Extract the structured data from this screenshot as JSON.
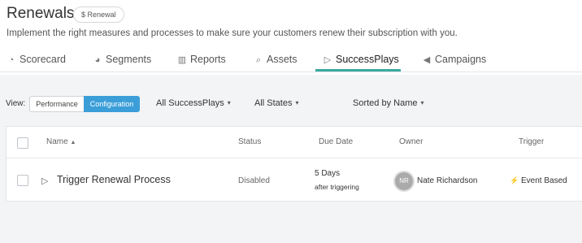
{
  "page": {
    "title": "Renewals",
    "badge": "$ Renewal",
    "subtitle": "Implement the right measures and processes to make sure your customers renew their subscription with you."
  },
  "tabs": [
    {
      "label": "Scorecard",
      "icon": "scorecard-icon"
    },
    {
      "label": "Segments",
      "icon": "segments-icon"
    },
    {
      "label": "Reports",
      "icon": "bar-chart-icon"
    },
    {
      "label": "Assets",
      "icon": "paperclip-icon"
    },
    {
      "label": "SuccessPlays",
      "icon": "play-icon",
      "active": true
    },
    {
      "label": "Campaigns",
      "icon": "megaphone-icon"
    }
  ],
  "accent_color": "#3aa99f",
  "toolbar": {
    "view_label": "View:",
    "view_options": [
      "Performance",
      "Configuration"
    ],
    "view_selected": "Configuration",
    "filter_plays": "All SuccessPlays",
    "filter_states": "All States",
    "sort": "Sorted by Name"
  },
  "table": {
    "columns": [
      "Name",
      "Status",
      "Due Date",
      "Owner",
      "Trigger"
    ],
    "sort_indicator": "▲",
    "rows": [
      {
        "name": "Trigger Renewal Process",
        "status": "Disabled",
        "due_line1": "5 Days",
        "due_line2": "after triggering",
        "owner_initials": "NR",
        "owner_name": "Nate Richardson",
        "trigger_icon": "lightning-icon",
        "trigger": "Event Based"
      }
    ]
  }
}
